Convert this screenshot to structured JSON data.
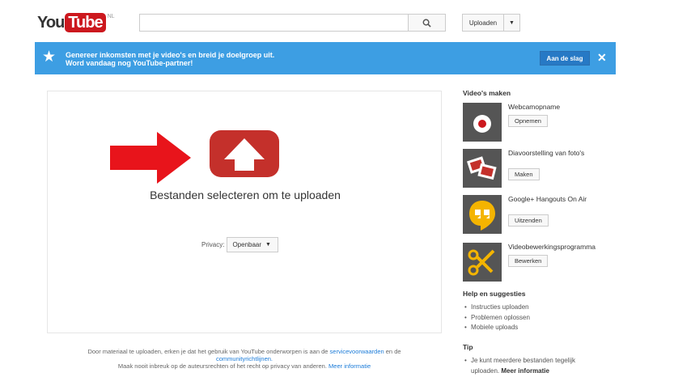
{
  "header": {
    "logo_you": "You",
    "logo_tube": "Tube",
    "logo_region": "NL",
    "search_placeholder": "",
    "upload_label": "Uploaden"
  },
  "banner": {
    "line1": "Genereer inkomsten met je video's en breid je doelgroep uit.",
    "line2": "Word vandaag nog YouTube-partner!",
    "button": "Aan de slag",
    "close": "✕",
    "star": "★"
  },
  "upload": {
    "title": "Bestanden selecteren om te uploaden",
    "privacy_label": "Privacy:",
    "privacy_value": "Openbaar"
  },
  "footer": {
    "text1": "Door materiaal te uploaden, erken je dat het gebruik van YouTube onderworpen is aan de",
    "link_terms": "servicevoorwaarden",
    "text2": "en de",
    "link_community": "communityrichtlijnen.",
    "text3": "Maak nooit inbreuk op de auteursrechten of het recht op privacy van anderen.",
    "link_more": "Meer informatie"
  },
  "sidebar": {
    "make_heading": "Video's maken",
    "tools": [
      {
        "title": "Webcamopname",
        "button": "Opnemen",
        "icon": "webcam-record-icon"
      },
      {
        "title": "Diavoorstelling van foto's",
        "button": "Maken",
        "icon": "photo-slideshow-icon"
      },
      {
        "title": "Google+ Hangouts On Air",
        "button": "Uitzenden",
        "icon": "hangouts-icon"
      },
      {
        "title": "Videobewerkingsprogramma",
        "button": "Bewerken",
        "icon": "scissors-icon"
      }
    ],
    "help_heading": "Help en suggesties",
    "help_items": [
      "Instructies uploaden",
      "Problemen oplossen",
      "Mobiele uploads"
    ],
    "tip_heading": "Tip",
    "tip_text": "Je kunt meerdere bestanden tegelijk uploaden.",
    "tip_link": "Meer informatie"
  },
  "colors": {
    "banner": "#3d9ee3",
    "youtube_red": "#c4302b",
    "arrow_red": "#e8141b",
    "link": "#1b7bd8"
  }
}
